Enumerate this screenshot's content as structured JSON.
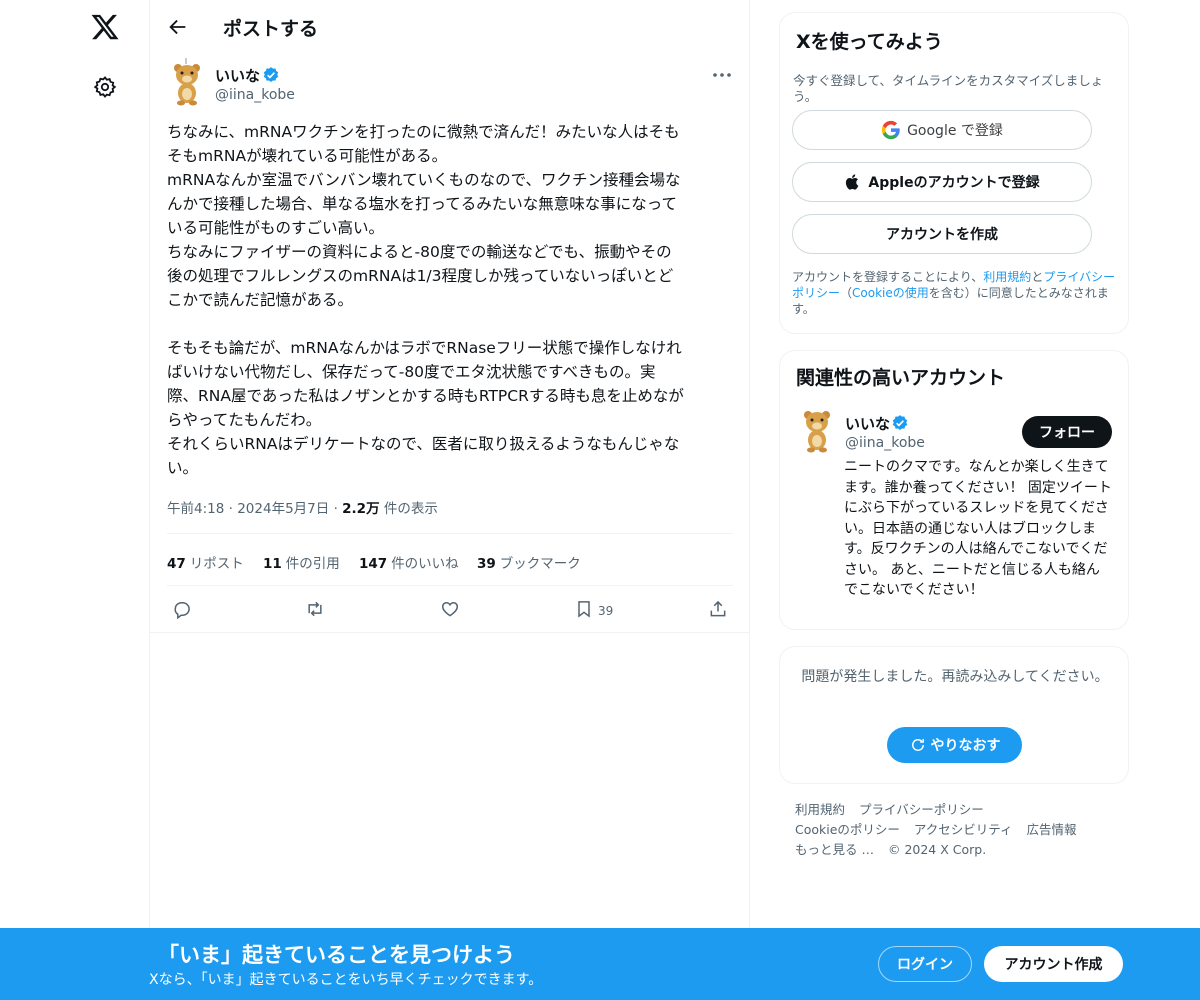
{
  "colors": {
    "accent": "#1d9bf0",
    "text": "#0f1419",
    "secondary": "#536471",
    "border": "#eff3f4"
  },
  "icons": {
    "logo": "x-logo-icon",
    "settings": "gear-icon",
    "back": "arrow-left-icon",
    "more": "more-dots-icon",
    "reply": "reply-icon",
    "repost": "repost-icon",
    "like": "heart-icon",
    "bookmark": "bookmark-icon",
    "share": "share-icon"
  },
  "header": {
    "title": "ポストする"
  },
  "tweet": {
    "author_name": "いいな",
    "handle": "@iina_kobe",
    "text": "ちなみに、mRNAワクチンを打ったのに微熱で済んだ！みたいな人はそも\nそもmRNAが壊れている可能性がある。\nmRNAなんか室温でバンバン壊れていくものなので、ワクチン接種会場な\nんかで接種した場合、単なる塩水を打ってるみたいな無意味な事になって\nいる可能性がものすごい高い。\nちなみにファイザーの資料によると-80度での輸送などでも、振動やその\n後の処理でフルレングスのmRNAは1/3程度しか残っていないっぽいとど\nこかで読んだ記憶がある。\n\nそもそも論だが、mRNAなんかはラボでRNaseフリー状態で操作しなけれ\nばいけない代物だし、保存だって-80度でエタ沈状態ですべきもの。実\n際、RNA屋であった私はノザンとかする時もRTPCRする時も息を止めなが\nらやってたもんだわ。\nそれくらいRNAはデリケートなので、医者に取り扱えるようなもんじゃな\nい。",
    "time": "午前4:18",
    "date": "2024年5月7日",
    "views_count": "2.2万",
    "views_label": "件の表示",
    "stats": {
      "reposts_count": "47",
      "reposts_label": "リポスト",
      "quotes_count": "11",
      "quotes_label": "件の引用",
      "likes_count": "147",
      "likes_label": "件のいいね",
      "bookmarks_count": "39",
      "bookmarks_label": "ブックマーク"
    },
    "bookmark_action_count": "39"
  },
  "signup_card": {
    "title": "Xを使ってみよう",
    "subtitle": "今すぐ登録して、タイムラインをカスタマイズしましょう。",
    "google_label": "Google で登録",
    "apple_label": "Appleのアカウントで登録",
    "create_label": "アカウントを作成",
    "legal_pre": "アカウントを登録することにより、",
    "terms_link": "利用規約",
    "legal_and": "と",
    "privacy_link": "プライバシーポリシー",
    "legal_mid": "（",
    "cookie_link": "Cookieの使用",
    "legal_post": "を含む）に同意したとみなされます。"
  },
  "related_card": {
    "title": "関連性の高いアカウント",
    "name": "いいな",
    "handle": "@iina_kobe",
    "follow_label": "フォロー",
    "bio": "ニートのクマです。なんとか楽しく生きてます。誰か養ってください！ 固定ツイートにぶら下がっているスレッドを見てください。日本語の通じない人はブロックします。反ワクチンの人は絡んでこないでください。 あと、ニートだと信じる人も絡んでこないでください！"
  },
  "error_card": {
    "message": "問題が発生しました。再読み込みしてください。",
    "retry_label": "やりなおす"
  },
  "footer": {
    "terms": "利用規約",
    "privacy": "プライバシーポリシー",
    "cookie": "Cookieのポリシー",
    "accessibility": "アクセシビリティ",
    "ads": "広告情報",
    "more": "もっと見る …",
    "copyright": "© 2024 X Corp."
  },
  "banner": {
    "title": "「いま」起きていることを見つけよう",
    "subtitle": "Xなら、「いま」起きていることをいち早くチェックできます。",
    "login_label": "ログイン",
    "signup_label": "アカウント作成"
  }
}
